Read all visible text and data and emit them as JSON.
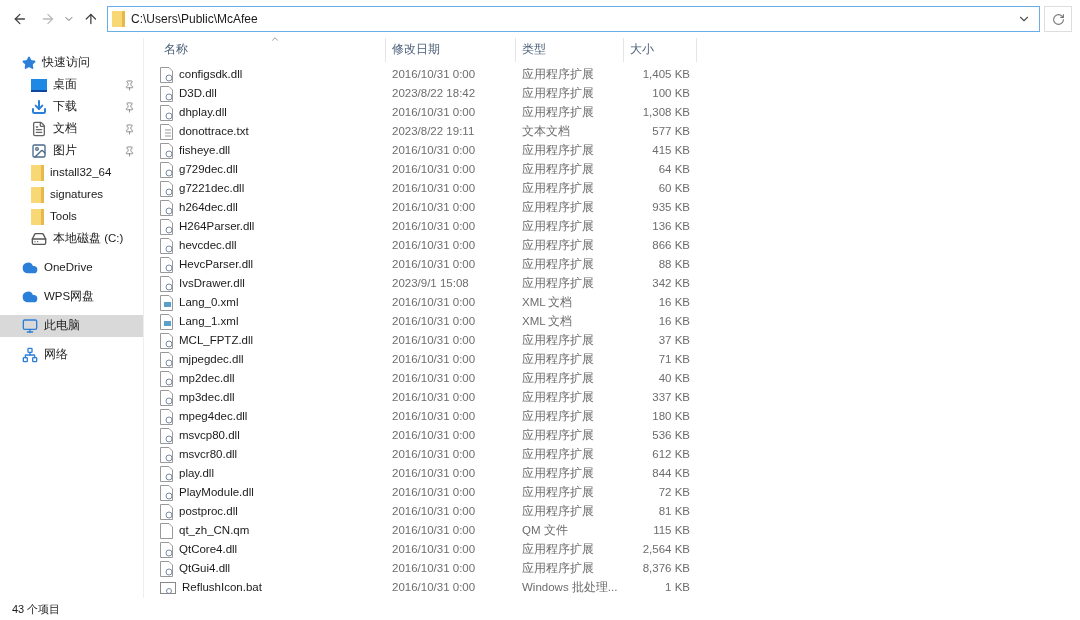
{
  "address_bar": {
    "path": "C:\\Users\\Public\\McAfee"
  },
  "sidebar": {
    "groups": [
      {
        "items": [
          {
            "kind": "star",
            "label": "快速访问",
            "pinned": false,
            "selected": false
          },
          {
            "kind": "desktop",
            "label": "桌面",
            "pinned": true,
            "selected": false
          },
          {
            "kind": "download",
            "label": "下载",
            "pinned": true,
            "selected": false
          },
          {
            "kind": "document",
            "label": "文档",
            "pinned": true,
            "selected": false
          },
          {
            "kind": "picture",
            "label": "图片",
            "pinned": true,
            "selected": false
          },
          {
            "kind": "folder",
            "label": "install32_64",
            "pinned": false,
            "selected": false
          },
          {
            "kind": "folder",
            "label": "signatures",
            "pinned": false,
            "selected": false
          },
          {
            "kind": "folder",
            "label": "Tools",
            "pinned": false,
            "selected": false
          },
          {
            "kind": "drive",
            "label": "本地磁盘 (C:)",
            "pinned": false,
            "selected": false
          }
        ]
      },
      {
        "items": [
          {
            "kind": "cloud",
            "label": "OneDrive",
            "pinned": false,
            "selected": false
          }
        ]
      },
      {
        "items": [
          {
            "kind": "cloud",
            "label": "WPS网盘",
            "pinned": false,
            "selected": false
          }
        ]
      },
      {
        "items": [
          {
            "kind": "computer",
            "label": "此电脑",
            "pinned": false,
            "selected": true
          }
        ]
      },
      {
        "items": [
          {
            "kind": "network",
            "label": "网络",
            "pinned": false,
            "selected": false
          }
        ]
      }
    ]
  },
  "table": {
    "columns": [
      "名称",
      "修改日期",
      "类型",
      "大小"
    ],
    "rows": [
      {
        "kind": "dll",
        "name": "configsdk.dll",
        "date": "2016/10/31 0:00",
        "type": "应用程序扩展",
        "size": "1,405 KB"
      },
      {
        "kind": "dll",
        "name": "D3D.dll",
        "date": "2023/8/22 18:42",
        "type": "应用程序扩展",
        "size": "100 KB"
      },
      {
        "kind": "dll",
        "name": "dhplay.dll",
        "date": "2016/10/31 0:00",
        "type": "应用程序扩展",
        "size": "1,308 KB"
      },
      {
        "kind": "txt",
        "name": "donottrace.txt",
        "date": "2023/8/22 19:11",
        "type": "文本文档",
        "size": "577 KB"
      },
      {
        "kind": "dll",
        "name": "fisheye.dll",
        "date": "2016/10/31 0:00",
        "type": "应用程序扩展",
        "size": "415 KB"
      },
      {
        "kind": "dll",
        "name": "g729dec.dll",
        "date": "2016/10/31 0:00",
        "type": "应用程序扩展",
        "size": "64 KB"
      },
      {
        "kind": "dll",
        "name": "g7221dec.dll",
        "date": "2016/10/31 0:00",
        "type": "应用程序扩展",
        "size": "60 KB"
      },
      {
        "kind": "dll",
        "name": "h264dec.dll",
        "date": "2016/10/31 0:00",
        "type": "应用程序扩展",
        "size": "935 KB"
      },
      {
        "kind": "dll",
        "name": "H264Parser.dll",
        "date": "2016/10/31 0:00",
        "type": "应用程序扩展",
        "size": "136 KB"
      },
      {
        "kind": "dll",
        "name": "hevcdec.dll",
        "date": "2016/10/31 0:00",
        "type": "应用程序扩展",
        "size": "866 KB"
      },
      {
        "kind": "dll",
        "name": "HevcParser.dll",
        "date": "2016/10/31 0:00",
        "type": "应用程序扩展",
        "size": "88 KB"
      },
      {
        "kind": "dll",
        "name": "IvsDrawer.dll",
        "date": "2023/9/1 15:08",
        "type": "应用程序扩展",
        "size": "342 KB"
      },
      {
        "kind": "xml",
        "name": "Lang_0.xml",
        "date": "2016/10/31 0:00",
        "type": "XML 文档",
        "size": "16 KB"
      },
      {
        "kind": "xml",
        "name": "Lang_1.xml",
        "date": "2016/10/31 0:00",
        "type": "XML 文档",
        "size": "16 KB"
      },
      {
        "kind": "dll",
        "name": "MCL_FPTZ.dll",
        "date": "2016/10/31 0:00",
        "type": "应用程序扩展",
        "size": "37 KB"
      },
      {
        "kind": "dll",
        "name": "mjpegdec.dll",
        "date": "2016/10/31 0:00",
        "type": "应用程序扩展",
        "size": "71 KB"
      },
      {
        "kind": "dll",
        "name": "mp2dec.dll",
        "date": "2016/10/31 0:00",
        "type": "应用程序扩展",
        "size": "40 KB"
      },
      {
        "kind": "dll",
        "name": "mp3dec.dll",
        "date": "2016/10/31 0:00",
        "type": "应用程序扩展",
        "size": "337 KB"
      },
      {
        "kind": "dll",
        "name": "mpeg4dec.dll",
        "date": "2016/10/31 0:00",
        "type": "应用程序扩展",
        "size": "180 KB"
      },
      {
        "kind": "dll",
        "name": "msvcp80.dll",
        "date": "2016/10/31 0:00",
        "type": "应用程序扩展",
        "size": "536 KB"
      },
      {
        "kind": "dll",
        "name": "msvcr80.dll",
        "date": "2016/10/31 0:00",
        "type": "应用程序扩展",
        "size": "612 KB"
      },
      {
        "kind": "dll",
        "name": "play.dll",
        "date": "2016/10/31 0:00",
        "type": "应用程序扩展",
        "size": "844 KB"
      },
      {
        "kind": "dll",
        "name": "PlayModule.dll",
        "date": "2016/10/31 0:00",
        "type": "应用程序扩展",
        "size": "72 KB"
      },
      {
        "kind": "dll",
        "name": "postproc.dll",
        "date": "2016/10/31 0:00",
        "type": "应用程序扩展",
        "size": "81 KB"
      },
      {
        "kind": "blank",
        "name": "qt_zh_CN.qm",
        "date": "2016/10/31 0:00",
        "type": "QM 文件",
        "size": "115 KB"
      },
      {
        "kind": "dll",
        "name": "QtCore4.dll",
        "date": "2016/10/31 0:00",
        "type": "应用程序扩展",
        "size": "2,564 KB"
      },
      {
        "kind": "dll",
        "name": "QtGui4.dll",
        "date": "2016/10/31 0:00",
        "type": "应用程序扩展",
        "size": "8,376 KB"
      },
      {
        "kind": "bat",
        "name": "ReflushIcon.bat",
        "date": "2016/10/31 0:00",
        "type": "Windows 批处理...",
        "size": "1 KB"
      }
    ]
  },
  "status_bar": {
    "item_count": "43 个项目"
  }
}
